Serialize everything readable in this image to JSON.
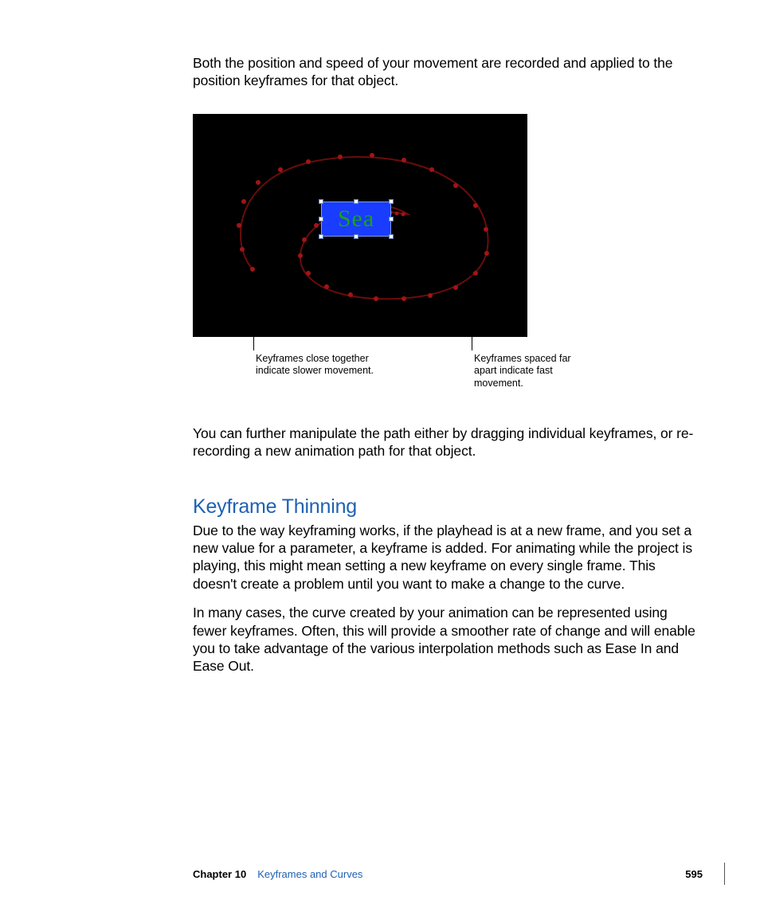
{
  "paragraphs": {
    "p1": "Both the position and speed of your movement are recorded and applied to the position keyframes for that object.",
    "p2": "You can further manipulate the path either by dragging individual keyframes, or re-recording a new animation path for that object.",
    "p3": "Due to the way keyframing works, if the playhead is at a new frame, and you set a new value for a parameter, a keyframe is added. For animating while the project is playing, this might mean setting a new keyframe on every single frame. This doesn't create a problem until you want to make a change to the curve.",
    "p4": "In many cases, the curve created by your animation can be represented using fewer keyframes. Often, this will provide a smoother rate of change and will enable you to take advantage of the various interpolation methods such as Ease In and Ease Out."
  },
  "heading": "Keyframe Thinning",
  "figure": {
    "sea_label": "Sea",
    "callout_left": "Keyframes close together indicate slower movement.",
    "callout_right": "Keyframes spaced far apart indicate fast movement."
  },
  "footer": {
    "chapter": "Chapter 10",
    "title": "Keyframes and Curves",
    "page": "595"
  }
}
